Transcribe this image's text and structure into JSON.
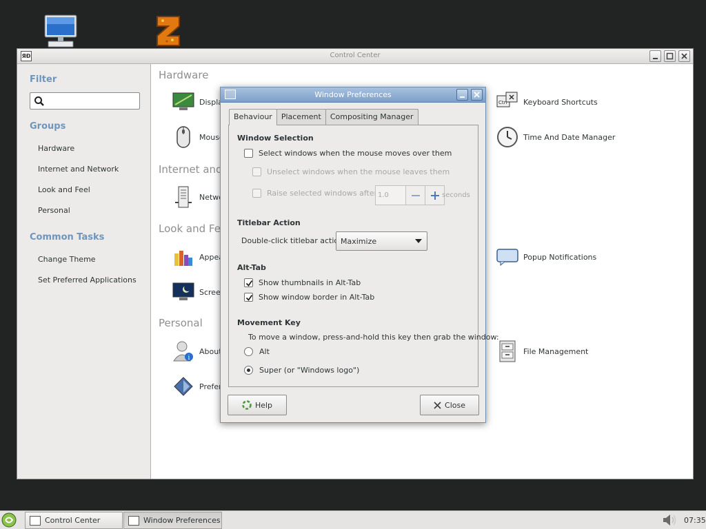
{
  "desktop": {
    "icons": [
      {
        "name": "computer-icon"
      },
      {
        "name": "game-icon"
      }
    ]
  },
  "control_center": {
    "title": "Control Center",
    "filter_heading": "Filter",
    "search": {
      "value": "",
      "placeholder": ""
    },
    "groups_heading": "Groups",
    "groups": [
      "Hardware",
      "Internet and Network",
      "Look and Feel",
      "Personal"
    ],
    "common_tasks_heading": "Common Tasks",
    "common_tasks": [
      "Change Theme",
      "Set Preferred Applications"
    ],
    "sections": {
      "hardware": "Hardware",
      "internet": "Internet and",
      "look": "Look and Fee",
      "personal": "Personal"
    },
    "items": {
      "display": "Displa",
      "mouse": "Mouse",
      "network": "Netwo",
      "appearance": "Appea",
      "screensaver": "Screen",
      "about_me": "About",
      "preferred": "Prefer",
      "keyboard_shortcuts": "Keyboard Shortcuts",
      "time_date": "Time And Date Manager",
      "popup_notifications": "Popup Notifications",
      "file_management": "File Management"
    }
  },
  "dialog": {
    "title": "Window Preferences",
    "tabs": [
      "Behaviour",
      "Placement",
      "Compositing Manager"
    ],
    "active_tab": "Behaviour",
    "window_selection": {
      "title": "Window Selection",
      "select_on_hover": "Select windows when the mouse moves over them",
      "unselect_on_leave": "Unselect windows when the mouse leaves them",
      "raise_after": "Raise selected windows after",
      "raise_value": "1.0",
      "seconds": "seconds"
    },
    "titlebar_action": {
      "title": "Titlebar Action",
      "label": "Double-click titlebar action:",
      "value": "Maximize"
    },
    "alt_tab": {
      "title": "Alt-Tab",
      "thumbnails": "Show thumbnails in Alt-Tab",
      "border": "Show window border in Alt-Tab"
    },
    "movement_key": {
      "title": "Movement Key",
      "description": "To move a window, press-and-hold this key then grab the window:",
      "option_alt": "Alt",
      "option_super": "Super (or \"Windows logo\")",
      "selected": "Super"
    },
    "help_label": "Help",
    "close_label": "Close"
  },
  "taskbar": {
    "tasks": [
      "Control Center",
      "Window Preferences"
    ],
    "clock": "07:35"
  }
}
